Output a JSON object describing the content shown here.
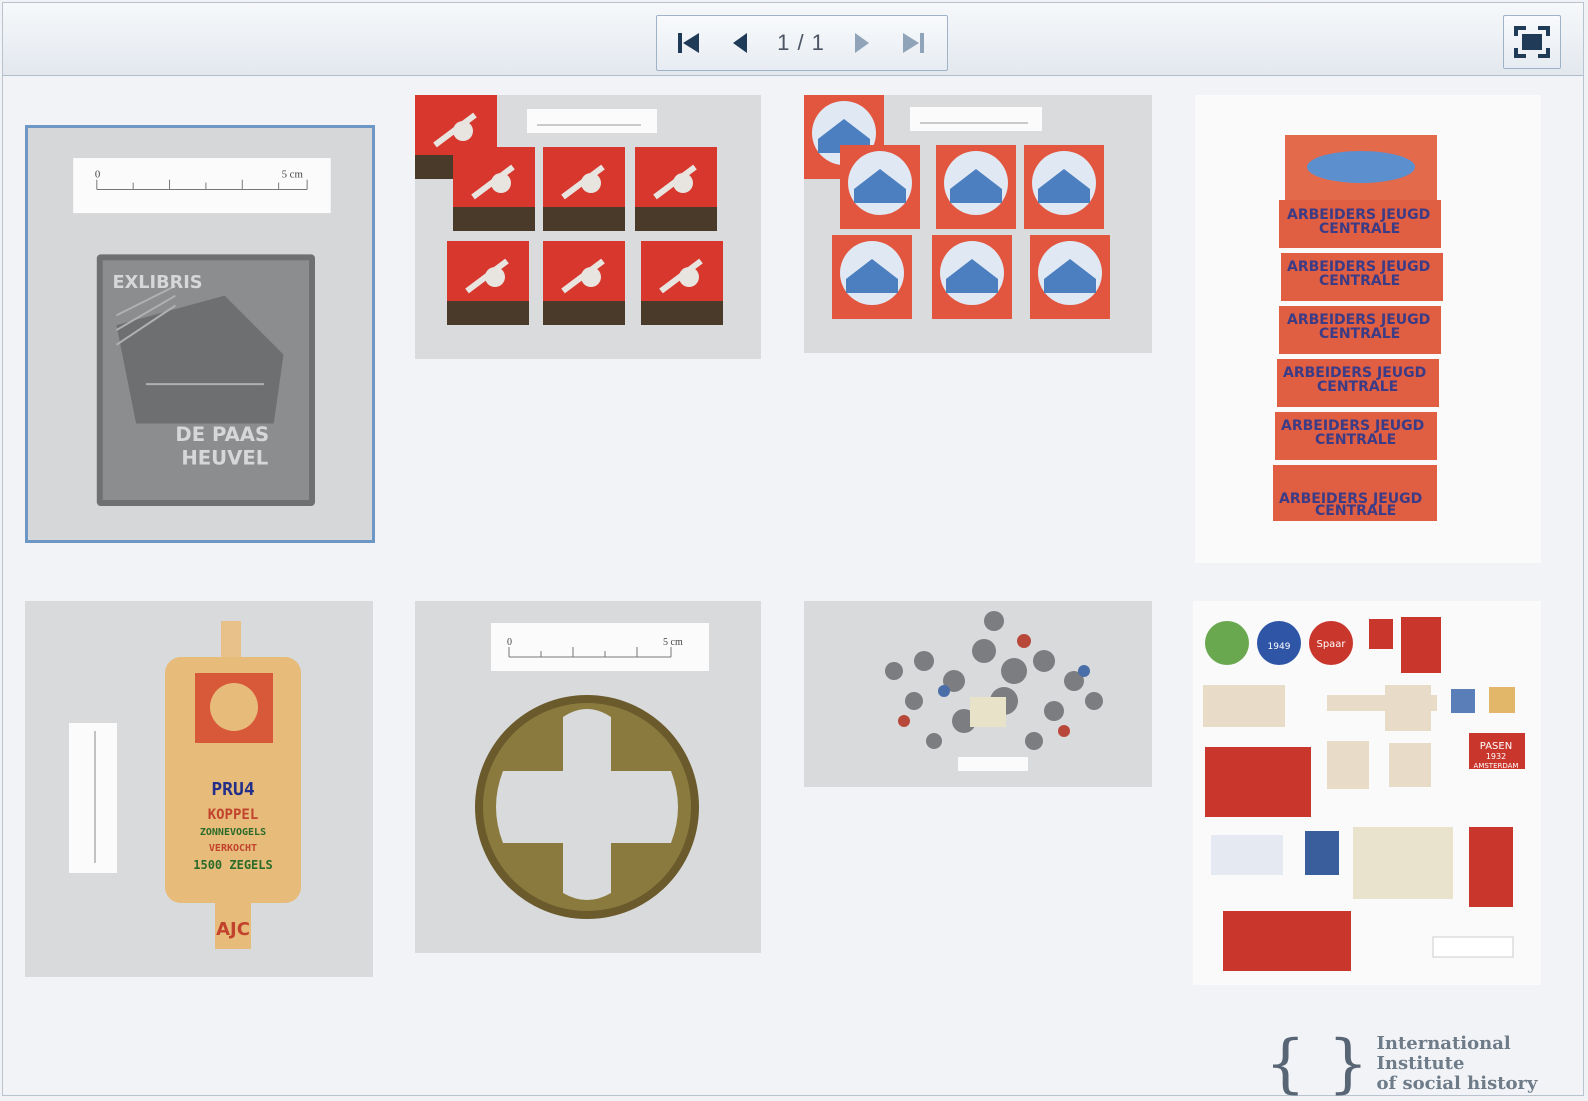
{
  "viewer": {
    "page_indicator": "1 / 1",
    "buttons": {
      "first": "first-page",
      "prev": "previous-page",
      "next": "next-page",
      "last": "last-page",
      "fullscreen": "fullscreen"
    }
  },
  "thumbnails": [
    {
      "id": "exlibris-plate",
      "selected": true
    },
    {
      "id": "matchbooks-violin"
    },
    {
      "id": "matchbooks-blue-print"
    },
    {
      "id": "matchbox-stack"
    },
    {
      "id": "wooden-pendant"
    },
    {
      "id": "brass-cross-disc"
    },
    {
      "id": "badges-collection"
    },
    {
      "id": "stamps-collection"
    }
  ],
  "thumb_text": {
    "scale_zero": "0",
    "scale_five": "5 cm",
    "exlibris_top": "EXLIBRIS",
    "exlibris_bottom1": "DE PAAS",
    "exlibris_bottom2": "HEUVEL",
    "matchbox_label1": "ARBEIDERS JEUGD",
    "matchbox_label2": "CENTRALE",
    "pendant_line1": "PRU4",
    "pendant_line2": "KOPPEL",
    "pendant_line3": "ZONNEVOGELS",
    "pendant_line4": "VERKOCHT",
    "pendant_line5": "1500 ZEGELS",
    "pendant_mark": "AJC",
    "stamp_year": "1949",
    "stamp_word": "Spaar",
    "stamp_pasen1": "PASEN",
    "stamp_pasen2": "1932",
    "stamp_pasen3": "AMSTERDAM"
  },
  "logo": {
    "brace_left": "{",
    "brace_right": "}",
    "line1": "International Institute",
    "line2": "of social history"
  },
  "colors": {
    "toolbar_border": "#aebccc",
    "selection_border": "#6e97c6",
    "icon_color": "#1f3b57"
  }
}
